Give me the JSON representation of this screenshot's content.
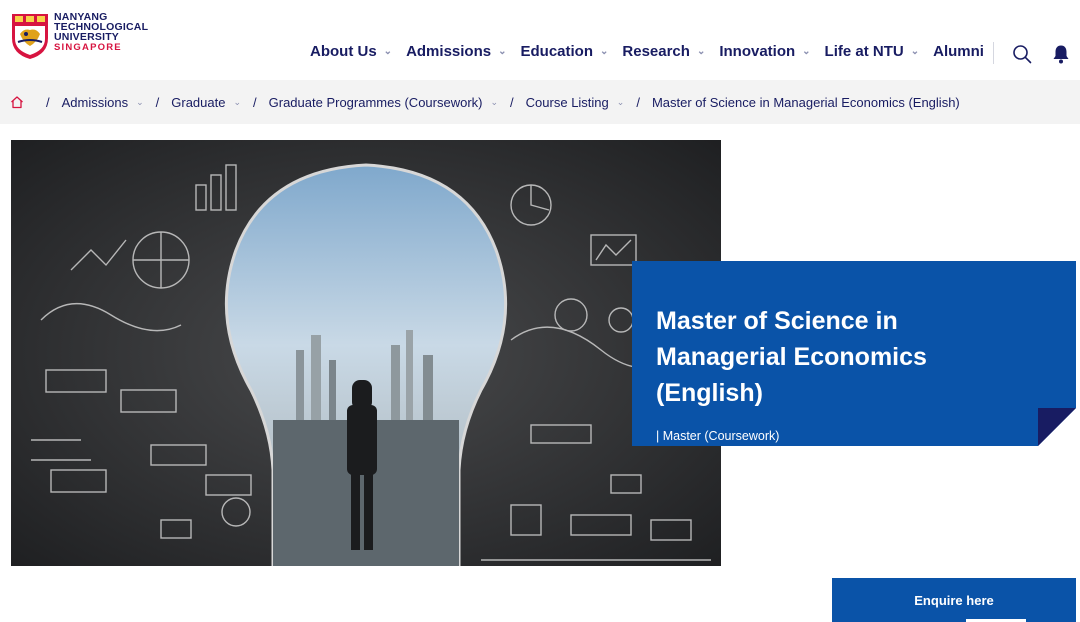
{
  "logo": {
    "line1": "NANYANG",
    "line2": "TECHNOLOGICAL",
    "line3": "UNIVERSITY",
    "line4": "SINGAPORE"
  },
  "nav": {
    "items": [
      {
        "label": "About Us",
        "dropdown": true
      },
      {
        "label": "Admissions",
        "dropdown": true
      },
      {
        "label": "Education",
        "dropdown": true
      },
      {
        "label": "Research",
        "dropdown": true
      },
      {
        "label": "Innovation",
        "dropdown": true
      },
      {
        "label": "Life at NTU",
        "dropdown": true
      },
      {
        "label": "Alumni",
        "dropdown": false
      }
    ],
    "search_icon": "search-icon",
    "bell_icon": "bell-icon"
  },
  "breadcrumb": {
    "home_icon": "home-icon",
    "items": [
      {
        "label": "Admissions"
      },
      {
        "label": "Graduate"
      },
      {
        "label": "Graduate Programmes (Coursework)"
      },
      {
        "label": "Course Listing"
      },
      {
        "label": "Master of Science in Managerial Economics (English)"
      }
    ]
  },
  "hero": {
    "title": "Master of Science in Managerial Economics (English)",
    "subtitle": "| Master (Coursework)"
  },
  "enquire": {
    "label": "Enquire here"
  },
  "colors": {
    "navy": "#181c62",
    "blue": "#0a53a8",
    "red": "#d71440",
    "breadcrumb_bg": "#f3f3f3"
  }
}
